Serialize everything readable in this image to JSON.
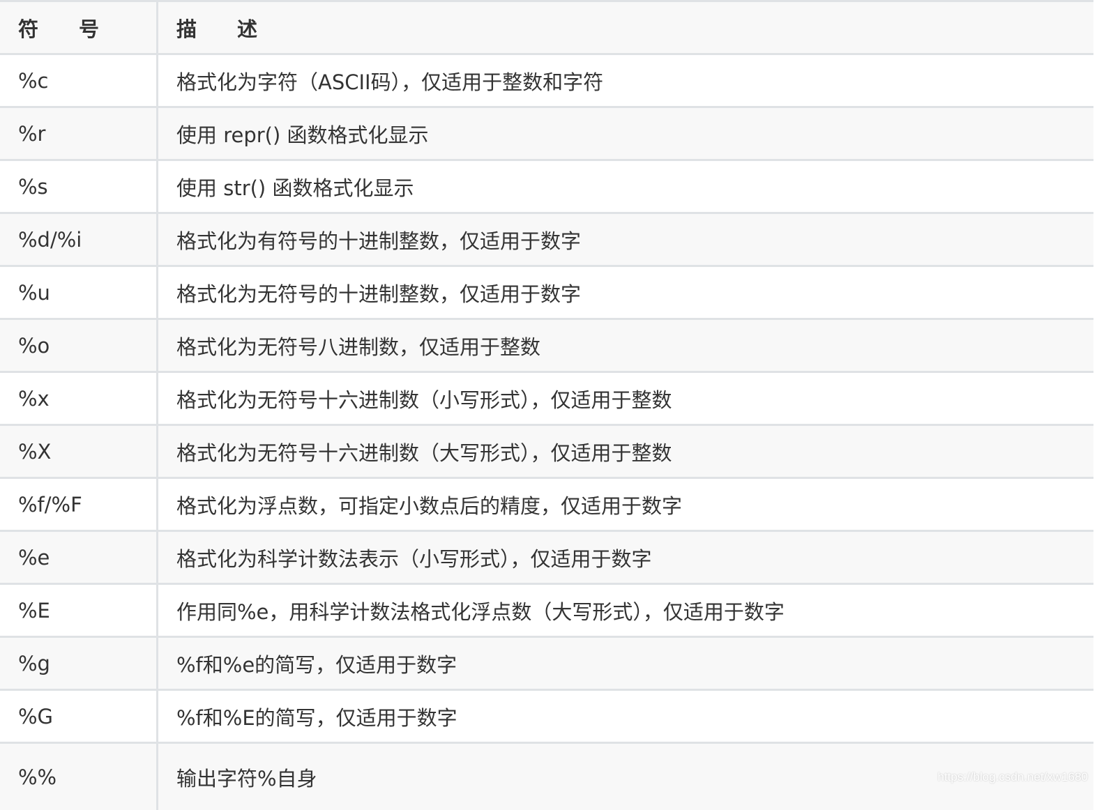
{
  "header": {
    "symbol": "符　　号",
    "description": "描　　述"
  },
  "rows": [
    {
      "symbol": "%c",
      "description": "格式化为字符（ASCII码），仅适用于整数和字符"
    },
    {
      "symbol": "%r",
      "description": "使用 repr() 函数格式化显示"
    },
    {
      "symbol": "%s",
      "description": "使用 str() 函数格式化显示"
    },
    {
      "symbol": "%d/%i",
      "description": "格式化为有符号的十进制整数，仅适用于数字"
    },
    {
      "symbol": "%u",
      "description": "格式化为无符号的十进制整数，仅适用于数字"
    },
    {
      "symbol": "%o",
      "description": "格式化为无符号八进制数，仅适用于整数"
    },
    {
      "symbol": "%x",
      "description": "格式化为无符号十六进制数（小写形式），仅适用于整数"
    },
    {
      "symbol": "%X",
      "description": "格式化为无符号十六进制数（大写形式），仅适用于整数"
    },
    {
      "symbol": "%f/%F",
      "description": "格式化为浮点数，可指定小数点后的精度，仅适用于数字"
    },
    {
      "symbol": "%e",
      "description": "格式化为科学计数法表示（小写形式），仅适用于数字"
    },
    {
      "symbol": "%E",
      "description": "作用同%e，用科学计数法格式化浮点数（大写形式），仅适用于数字"
    },
    {
      "symbol": "%g",
      "description": "%f和%e的简写，仅适用于数字"
    },
    {
      "symbol": "%G",
      "description": "%f和%E的简写，仅适用于数字"
    },
    {
      "symbol": "%%",
      "description": "输出字符%自身"
    }
  ],
  "watermark": "https://blog.csdn.net/xw1680"
}
